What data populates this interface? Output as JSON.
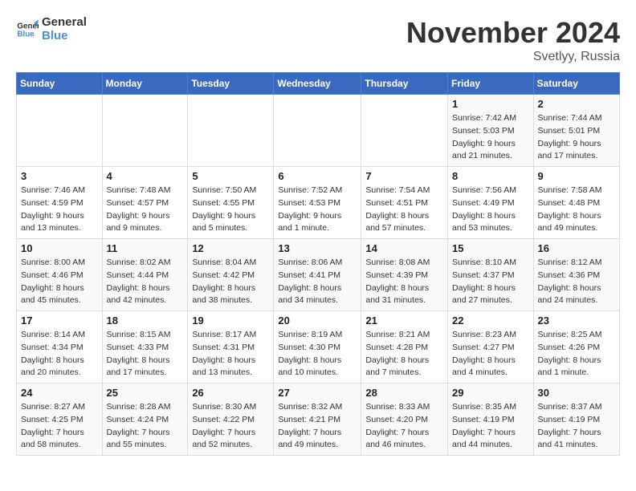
{
  "logo": {
    "text1": "General",
    "text2": "Blue"
  },
  "title": "November 2024",
  "location": "Svetlyy, Russia",
  "weekdays": [
    "Sunday",
    "Monday",
    "Tuesday",
    "Wednesday",
    "Thursday",
    "Friday",
    "Saturday"
  ],
  "weeks": [
    [
      {
        "day": "",
        "info": ""
      },
      {
        "day": "",
        "info": ""
      },
      {
        "day": "",
        "info": ""
      },
      {
        "day": "",
        "info": ""
      },
      {
        "day": "",
        "info": ""
      },
      {
        "day": "1",
        "info": "Sunrise: 7:42 AM\nSunset: 5:03 PM\nDaylight: 9 hours and 21 minutes."
      },
      {
        "day": "2",
        "info": "Sunrise: 7:44 AM\nSunset: 5:01 PM\nDaylight: 9 hours and 17 minutes."
      }
    ],
    [
      {
        "day": "3",
        "info": "Sunrise: 7:46 AM\nSunset: 4:59 PM\nDaylight: 9 hours and 13 minutes."
      },
      {
        "day": "4",
        "info": "Sunrise: 7:48 AM\nSunset: 4:57 PM\nDaylight: 9 hours and 9 minutes."
      },
      {
        "day": "5",
        "info": "Sunrise: 7:50 AM\nSunset: 4:55 PM\nDaylight: 9 hours and 5 minutes."
      },
      {
        "day": "6",
        "info": "Sunrise: 7:52 AM\nSunset: 4:53 PM\nDaylight: 9 hours and 1 minute."
      },
      {
        "day": "7",
        "info": "Sunrise: 7:54 AM\nSunset: 4:51 PM\nDaylight: 8 hours and 57 minutes."
      },
      {
        "day": "8",
        "info": "Sunrise: 7:56 AM\nSunset: 4:49 PM\nDaylight: 8 hours and 53 minutes."
      },
      {
        "day": "9",
        "info": "Sunrise: 7:58 AM\nSunset: 4:48 PM\nDaylight: 8 hours and 49 minutes."
      }
    ],
    [
      {
        "day": "10",
        "info": "Sunrise: 8:00 AM\nSunset: 4:46 PM\nDaylight: 8 hours and 45 minutes."
      },
      {
        "day": "11",
        "info": "Sunrise: 8:02 AM\nSunset: 4:44 PM\nDaylight: 8 hours and 42 minutes."
      },
      {
        "day": "12",
        "info": "Sunrise: 8:04 AM\nSunset: 4:42 PM\nDaylight: 8 hours and 38 minutes."
      },
      {
        "day": "13",
        "info": "Sunrise: 8:06 AM\nSunset: 4:41 PM\nDaylight: 8 hours and 34 minutes."
      },
      {
        "day": "14",
        "info": "Sunrise: 8:08 AM\nSunset: 4:39 PM\nDaylight: 8 hours and 31 minutes."
      },
      {
        "day": "15",
        "info": "Sunrise: 8:10 AM\nSunset: 4:37 PM\nDaylight: 8 hours and 27 minutes."
      },
      {
        "day": "16",
        "info": "Sunrise: 8:12 AM\nSunset: 4:36 PM\nDaylight: 8 hours and 24 minutes."
      }
    ],
    [
      {
        "day": "17",
        "info": "Sunrise: 8:14 AM\nSunset: 4:34 PM\nDaylight: 8 hours and 20 minutes."
      },
      {
        "day": "18",
        "info": "Sunrise: 8:15 AM\nSunset: 4:33 PM\nDaylight: 8 hours and 17 minutes."
      },
      {
        "day": "19",
        "info": "Sunrise: 8:17 AM\nSunset: 4:31 PM\nDaylight: 8 hours and 13 minutes."
      },
      {
        "day": "20",
        "info": "Sunrise: 8:19 AM\nSunset: 4:30 PM\nDaylight: 8 hours and 10 minutes."
      },
      {
        "day": "21",
        "info": "Sunrise: 8:21 AM\nSunset: 4:28 PM\nDaylight: 8 hours and 7 minutes."
      },
      {
        "day": "22",
        "info": "Sunrise: 8:23 AM\nSunset: 4:27 PM\nDaylight: 8 hours and 4 minutes."
      },
      {
        "day": "23",
        "info": "Sunrise: 8:25 AM\nSunset: 4:26 PM\nDaylight: 8 hours and 1 minute."
      }
    ],
    [
      {
        "day": "24",
        "info": "Sunrise: 8:27 AM\nSunset: 4:25 PM\nDaylight: 7 hours and 58 minutes."
      },
      {
        "day": "25",
        "info": "Sunrise: 8:28 AM\nSunset: 4:24 PM\nDaylight: 7 hours and 55 minutes."
      },
      {
        "day": "26",
        "info": "Sunrise: 8:30 AM\nSunset: 4:22 PM\nDaylight: 7 hours and 52 minutes."
      },
      {
        "day": "27",
        "info": "Sunrise: 8:32 AM\nSunset: 4:21 PM\nDaylight: 7 hours and 49 minutes."
      },
      {
        "day": "28",
        "info": "Sunrise: 8:33 AM\nSunset: 4:20 PM\nDaylight: 7 hours and 46 minutes."
      },
      {
        "day": "29",
        "info": "Sunrise: 8:35 AM\nSunset: 4:19 PM\nDaylight: 7 hours and 44 minutes."
      },
      {
        "day": "30",
        "info": "Sunrise: 8:37 AM\nSunset: 4:19 PM\nDaylight: 7 hours and 41 minutes."
      }
    ]
  ]
}
